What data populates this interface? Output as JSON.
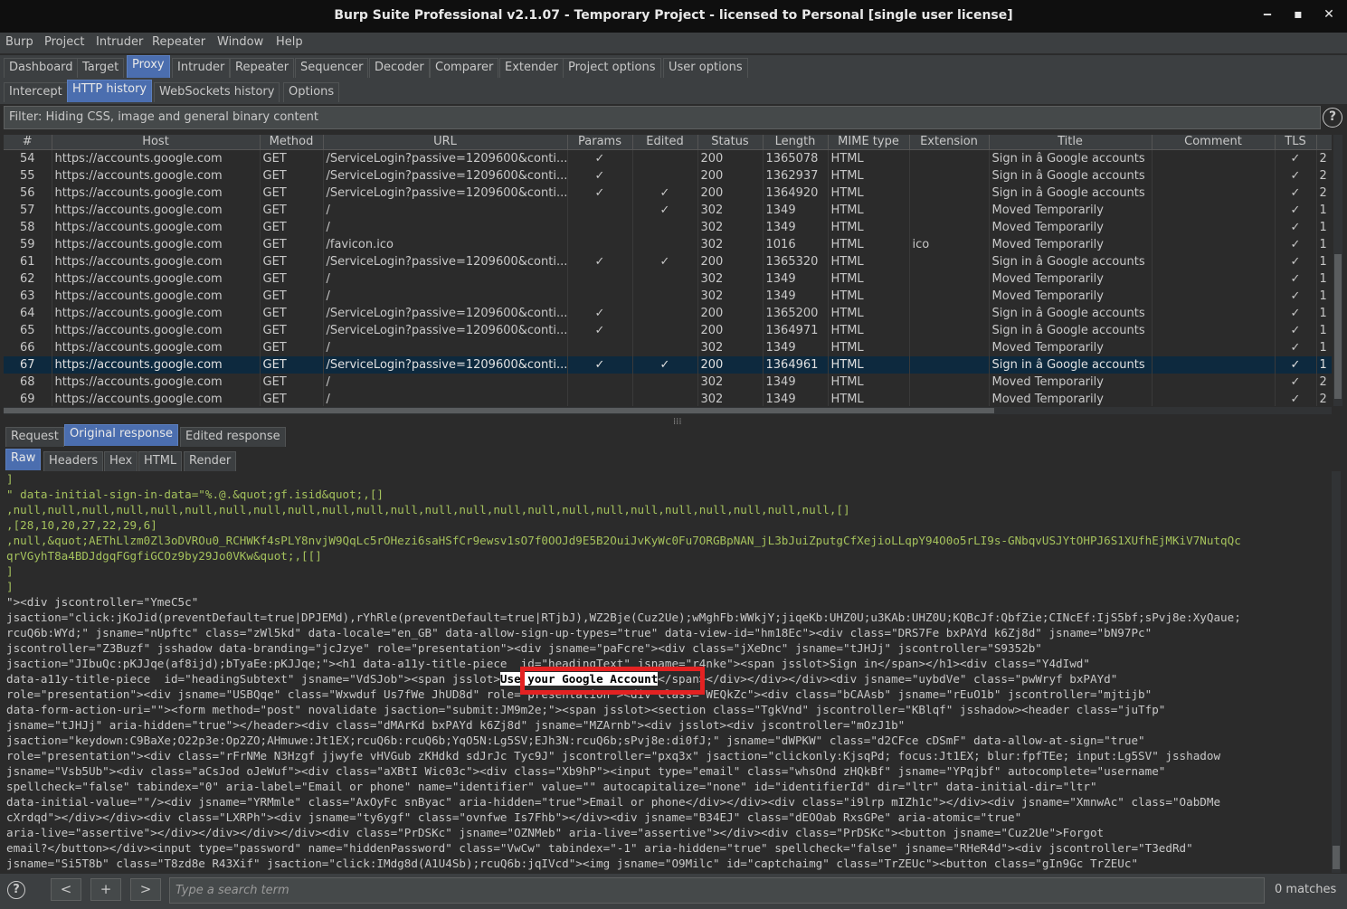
{
  "window": {
    "title": "Burp Suite Professional v2.1.07 - Temporary Project - licensed to Personal [single user license]",
    "controls": [
      "minimize-icon",
      "maximize-icon",
      "close-icon"
    ]
  },
  "menu": [
    "Burp",
    "Project",
    "Intruder",
    "Repeater",
    "Window",
    "Help"
  ],
  "main_tabs": [
    "Dashboard",
    "Target",
    "Proxy",
    "Intruder",
    "Repeater",
    "Sequencer",
    "Decoder",
    "Comparer",
    "Extender",
    "Project options",
    "User options"
  ],
  "main_tab_active": "Proxy",
  "proxy_tabs": [
    "Intercept",
    "HTTP history",
    "WebSockets history",
    "Options"
  ],
  "proxy_tab_active": "HTTP history",
  "filter": "Filter: Hiding CSS, image and general binary content",
  "table": {
    "columns": [
      "#",
      "Host",
      "Method",
      "URL",
      "Params",
      "Edited",
      "Status",
      "Length",
      "MIME type",
      "Extension",
      "Title",
      "Comment",
      "TLS",
      ""
    ],
    "rows": [
      {
        "n": "54",
        "host": "https://accounts.google.com",
        "method": "GET",
        "url": "/ServiceLogin?passive=1209600&conti...",
        "params": "✓",
        "edited": "",
        "status": "200",
        "length": "1365078",
        "mime": "HTML",
        "ext": "",
        "title": "Sign in â Google accounts",
        "comment": "",
        "tls": "✓",
        "extra": "2"
      },
      {
        "n": "55",
        "host": "https://accounts.google.com",
        "method": "GET",
        "url": "/ServiceLogin?passive=1209600&conti...",
        "params": "✓",
        "edited": "",
        "status": "200",
        "length": "1362937",
        "mime": "HTML",
        "ext": "",
        "title": "Sign in â Google accounts",
        "comment": "",
        "tls": "✓",
        "extra": "2"
      },
      {
        "n": "56",
        "host": "https://accounts.google.com",
        "method": "GET",
        "url": "/ServiceLogin?passive=1209600&conti...",
        "params": "✓",
        "edited": "✓",
        "status": "200",
        "length": "1364920",
        "mime": "HTML",
        "ext": "",
        "title": "Sign in â Google accounts",
        "comment": "",
        "tls": "✓",
        "extra": "2"
      },
      {
        "n": "57",
        "host": "https://accounts.google.com",
        "method": "GET",
        "url": "/",
        "params": "",
        "edited": "✓",
        "status": "302",
        "length": "1349",
        "mime": "HTML",
        "ext": "",
        "title": "Moved Temporarily",
        "comment": "",
        "tls": "✓",
        "extra": "1"
      },
      {
        "n": "58",
        "host": "https://accounts.google.com",
        "method": "GET",
        "url": "/",
        "params": "",
        "edited": "",
        "status": "302",
        "length": "1349",
        "mime": "HTML",
        "ext": "",
        "title": "Moved Temporarily",
        "comment": "",
        "tls": "✓",
        "extra": "1"
      },
      {
        "n": "59",
        "host": "https://accounts.google.com",
        "method": "GET",
        "url": "/favicon.ico",
        "params": "",
        "edited": "",
        "status": "302",
        "length": "1016",
        "mime": "HTML",
        "ext": "ico",
        "title": "Moved Temporarily",
        "comment": "",
        "tls": "✓",
        "extra": "1"
      },
      {
        "n": "61",
        "host": "https://accounts.google.com",
        "method": "GET",
        "url": "/ServiceLogin?passive=1209600&conti...",
        "params": "✓",
        "edited": "✓",
        "status": "200",
        "length": "1365320",
        "mime": "HTML",
        "ext": "",
        "title": "Sign in â Google accounts",
        "comment": "",
        "tls": "✓",
        "extra": "1"
      },
      {
        "n": "62",
        "host": "https://accounts.google.com",
        "method": "GET",
        "url": "/",
        "params": "",
        "edited": "",
        "status": "302",
        "length": "1349",
        "mime": "HTML",
        "ext": "",
        "title": "Moved Temporarily",
        "comment": "",
        "tls": "✓",
        "extra": "1"
      },
      {
        "n": "63",
        "host": "https://accounts.google.com",
        "method": "GET",
        "url": "/",
        "params": "",
        "edited": "",
        "status": "302",
        "length": "1349",
        "mime": "HTML",
        "ext": "",
        "title": "Moved Temporarily",
        "comment": "",
        "tls": "✓",
        "extra": "1"
      },
      {
        "n": "64",
        "host": "https://accounts.google.com",
        "method": "GET",
        "url": "/ServiceLogin?passive=1209600&conti...",
        "params": "✓",
        "edited": "",
        "status": "200",
        "length": "1365200",
        "mime": "HTML",
        "ext": "",
        "title": "Sign in â Google accounts",
        "comment": "",
        "tls": "✓",
        "extra": "1"
      },
      {
        "n": "65",
        "host": "https://accounts.google.com",
        "method": "GET",
        "url": "/ServiceLogin?passive=1209600&conti...",
        "params": "✓",
        "edited": "",
        "status": "200",
        "length": "1364971",
        "mime": "HTML",
        "ext": "",
        "title": "Sign in â Google accounts",
        "comment": "",
        "tls": "✓",
        "extra": "1"
      },
      {
        "n": "66",
        "host": "https://accounts.google.com",
        "method": "GET",
        "url": "/",
        "params": "",
        "edited": "",
        "status": "302",
        "length": "1349",
        "mime": "HTML",
        "ext": "",
        "title": "Moved Temporarily",
        "comment": "",
        "tls": "✓",
        "extra": "1"
      },
      {
        "n": "67",
        "host": "https://accounts.google.com",
        "method": "GET",
        "url": "/ServiceLogin?passive=1209600&conti...",
        "params": "✓",
        "edited": "✓",
        "status": "200",
        "length": "1364961",
        "mime": "HTML",
        "ext": "",
        "title": "Sign in â Google accounts",
        "comment": "",
        "tls": "✓",
        "extra": "1",
        "selected": true
      },
      {
        "n": "68",
        "host": "https://accounts.google.com",
        "method": "GET",
        "url": "/",
        "params": "",
        "edited": "",
        "status": "302",
        "length": "1349",
        "mime": "HTML",
        "ext": "",
        "title": "Moved Temporarily",
        "comment": "",
        "tls": "✓",
        "extra": "2"
      },
      {
        "n": "69",
        "host": "https://accounts.google.com",
        "method": "GET",
        "url": "/",
        "params": "",
        "edited": "",
        "status": "302",
        "length": "1349",
        "mime": "HTML",
        "ext": "",
        "title": "Moved Temporarily",
        "comment": "",
        "tls": "✓",
        "extra": "2"
      }
    ]
  },
  "response_tabs": [
    "Request",
    "Original response",
    "Edited response"
  ],
  "response_tab_active": "Original response",
  "view_tabs": [
    "Raw",
    "Headers",
    "Hex",
    "HTML",
    "Render"
  ],
  "view_tab_active": "Raw",
  "code_lines": [
    {
      "text": "]",
      "style": "g"
    },
    {
      "text": "\" data-initial-sign-in-data=\"%.@.&quot;gf.isid&quot;,[]",
      "style": "g"
    },
    {
      "text": ",null,null,null,null,null,null,null,null,null,null,null,null,null,null,null,null,null,null,null,null,null,null,null,null,[]",
      "style": "g"
    },
    {
      "text": ",[28,10,20,27,22,29,6]",
      "style": "g"
    },
    {
      "text": ",null,&quot;AEThLlzm0Zl3oDVROu0_RCHWKf4sPLY8nvjW9QqLc5rOHezi6saHSfCr9ewsv1sO7f0OOJd9E5B2OuiJvKyWc0Fu7ORGBpNAN_jL3bJuiZputgCfXejioLLqpY94O0o5rLI9s-GNbqvUSJYtOHPJ6S1XUfhEjMKiV7NutqQc",
      "style": "g"
    },
    {
      "text": "qrVGyhT8a4BDJdgqFGgfiGCOz9by29Jo0VKw&quot;,[[]",
      "style": "g"
    },
    {
      "text": "]",
      "style": "g"
    },
    {
      "text": "]",
      "style": "g"
    },
    {
      "text": "\"><div jscontroller=\"YmeC5c\"",
      "style": "m"
    },
    {
      "text": "jsaction=\"click:jKoJid(preventDefault=true|DPJEMd),rYhRle(preventDefault=true|RTjbJ),WZ2Bje(Cuz2Ue);wMghFb:WWkjY;jiqeKb:UHZ0U;u3KAb:UHZ0U;KQBcJf:QbfZie;CINcEf:IjS5bf;sPvj8e:XyQaue;",
      "style": "m"
    },
    {
      "text": "rcuQ6b:WYd;\" jsname=\"nUpftc\" class=\"zWl5kd\" data-locale=\"en_GB\" data-allow-sign-up-types=\"true\" data-view-id=\"hm18Ec\"><div class=\"DRS7Fe bxPAYd k6Zj8d\" jsname=\"bN97Pc\"",
      "style": "m"
    },
    {
      "text": "jscontroller=\"Z3Buzf\" jsshadow data-branding=\"jcJzye\" role=\"presentation\"><div jsname=\"paFcre\"><div class=\"jXeDnc\" jsname=\"tJHJj\" jscontroller=\"S9352b\"",
      "style": "m"
    },
    {
      "text": "jsaction=\"JIbuQc:pKJJqe(af8ijd);bTyaEe:pKJJqe;\"><h1 data-a11y-title-piece  id=\"headingText\" jsname=\"r4nke\"><span jsslot>Sign in</span></h1><div class=\"Y4dIwd\"",
      "style": "m"
    },
    {
      "text": "data-a11y-title-piece  id=\"headingSubtext\" jsname=\"VdSJob\"><span jsslot>Use your Google Account</span></div></div></div><div jsname=\"uybdVe\" class=\"pwWryf bxPAYd\"",
      "style": "m",
      "highlight": "Use your Google Account"
    },
    {
      "text": "role=\"presentation\"><div jsname=\"USBQqe\" class=\"Wxwduf Us7fWe JhUD8d\" role=\"presentation\"><div class=\"WEQkZc\"><div class=\"bCAAsb\" jsname=\"rEuO1b\" jscontroller=\"mjtijb\"",
      "style": "m"
    },
    {
      "text": "data-form-action-uri=\"\"><form method=\"post\" novalidate jsaction=\"submit:JM9m2e;\"><span jsslot><section class=\"TgkVnd\" jscontroller=\"KBlqf\" jsshadow><header class=\"juTfp\"",
      "style": "m"
    },
    {
      "text": "jsname=\"tJHJj\" aria-hidden=\"true\"></header><div class=\"dMArKd bxPAYd k6Zj8d\" jsname=\"MZArnb\"><div jsslot><div jscontroller=\"mOzJ1b\"",
      "style": "m"
    },
    {
      "text": "jsaction=\"keydown:C9BaXe;O22p3e:Op2ZO;AHmuwe:Jt1EX;rcuQ6b:rcuQ6b;YqO5N:Lg5SV;EJh3N:rcuQ6b;sPvj8e:di0fJ;\" jsname=\"dWPKW\" class=\"d2CFce cDSmF\" data-allow-at-sign=\"true\"",
      "style": "m"
    },
    {
      "text": "role=\"presentation\"><div class=\"rFrNMe N3Hzgf jjwyfe vHVGub zKHdkd sdJrJc Tyc9J\" jscontroller=\"pxq3x\" jsaction=\"clickonly:KjsqPd; focus:Jt1EX; blur:fpfTEe; input:Lg5SV\" jsshadow",
      "style": "m"
    },
    {
      "text": "jsname=\"Vsb5Ub\"><div class=\"aCsJod oJeWuf\"><div class=\"aXBtI Wic03c\"><div class=\"Xb9hP\"><input type=\"email\" class=\"whsOnd zHQkBf\" jsname=\"YPqjbf\" autocomplete=\"username\"",
      "style": "m"
    },
    {
      "text": "spellcheck=\"false\" tabindex=\"0\" aria-label=\"Email or phone\" name=\"identifier\" value=\"\" autocapitalize=\"none\" id=\"identifierId\" dir=\"ltr\" data-initial-dir=\"ltr\"",
      "style": "m"
    },
    {
      "text": "data-initial-value=\"\"/><div jsname=\"YRMmle\" class=\"AxOyFc snByac\" aria-hidden=\"true\">Email or phone</div></div><div class=\"i9lrp mIZh1c\"></div><div jsname=\"XmnwAc\" class=\"OabDMe",
      "style": "m"
    },
    {
      "text": "cXrdqd\"></div></div><div class=\"LXRPh\"><div jsname=\"ty6ygf\" class=\"ovnfwe Is7Fhb\"></div><div jsname=\"B34EJ\" class=\"dEOOab RxsGPe\" aria-atomic=\"true\"",
      "style": "m"
    },
    {
      "text": "aria-live=\"assertive\"></div></div></div></div><div class=\"PrDSKc\" jsname=\"OZNMeb\" aria-live=\"assertive\"></div><div class=\"PrDSKc\"><button jsname=\"Cuz2Ue\">Forgot",
      "style": "m"
    },
    {
      "text": "email?</button></div><input type=\"password\" name=\"hiddenPassword\" class=\"VwCw\" tabindex=\"-1\" aria-hidden=\"true\" spellcheck=\"false\" jsname=\"RHeR4d\"><div jscontroller=\"T3edRd\"",
      "style": "m"
    },
    {
      "text": "jsname=\"Si5T8b\" class=\"T8zd8e R43Xif\" jsaction=\"click:IMdg8d(A1U4Sb);rcuQ6b:jqIVcd\"><img jsname=\"O9Milc\" id=\"captchaimg\" class=\"TrZEUc\"><button class=\"gIn9Gc TrZEUc\"",
      "style": "m"
    }
  ],
  "search": {
    "placeholder": "Type a search term",
    "prev": "<",
    "add": "+",
    "next": ">",
    "matches": "0 matches"
  },
  "colors": {
    "accent": "#4b6eaf",
    "selected_row": "#0d293e",
    "attr_value": "#a5c25c",
    "annotation_box": "#e32222"
  }
}
